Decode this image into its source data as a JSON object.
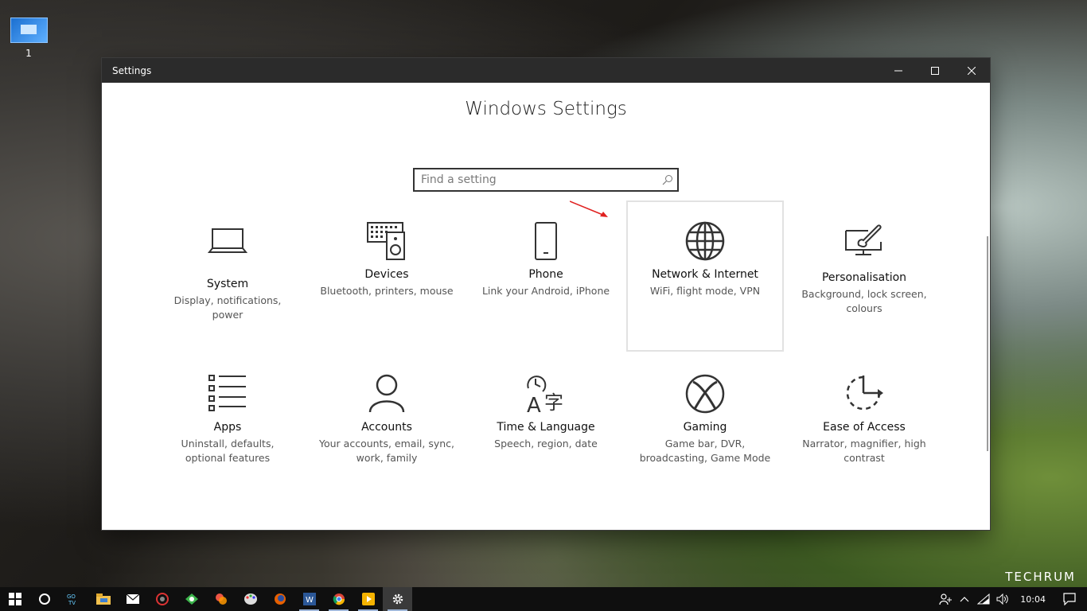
{
  "desktop": {
    "icon_label": "1",
    "watermark": "TECHRUM"
  },
  "window": {
    "title": "Settings",
    "controls": [
      "minimize",
      "maximize",
      "close"
    ]
  },
  "page": {
    "title": "Windows Settings",
    "search_placeholder": "Find a setting"
  },
  "tiles": [
    {
      "name": "System",
      "desc": "Display, notifications, power",
      "icon": "laptop-icon"
    },
    {
      "name": "Devices",
      "desc": "Bluetooth, printers, mouse",
      "icon": "keyboard-speaker-icon"
    },
    {
      "name": "Phone",
      "desc": "Link your Android, iPhone",
      "icon": "phone-icon"
    },
    {
      "name": "Network & Internet",
      "desc": "WiFi, flight mode, VPN",
      "icon": "globe-icon",
      "highlighted": true
    },
    {
      "name": "Personalisation",
      "desc": "Background, lock screen, colours",
      "icon": "paint-brush-icon"
    },
    {
      "name": "Apps",
      "desc": "Uninstall, defaults, optional features",
      "icon": "list-icon"
    },
    {
      "name": "Accounts",
      "desc": "Your accounts, email, sync, work, family",
      "icon": "person-icon"
    },
    {
      "name": "Time & Language",
      "desc": "Speech, region, date",
      "icon": "clock-language-icon"
    },
    {
      "name": "Gaming",
      "desc": "Game bar, DVR, broadcasting, Game Mode",
      "icon": "xbox-icon"
    },
    {
      "name": "Ease of Access",
      "desc": "Narrator, magnifier, high contrast",
      "icon": "ease-of-access-icon"
    }
  ],
  "taskbar": {
    "apps": [
      "start",
      "cortana",
      "gotv",
      "file-explorer",
      "mail",
      "app-red",
      "app-green",
      "app-multi",
      "app-paint",
      "firefox",
      "word",
      "chrome",
      "media-player",
      "settings"
    ],
    "clock": "10:04"
  },
  "colors": {
    "titlebar": "#2b2b2b",
    "taskbar": "#0f0f0f",
    "arrow": "#e0201f"
  }
}
